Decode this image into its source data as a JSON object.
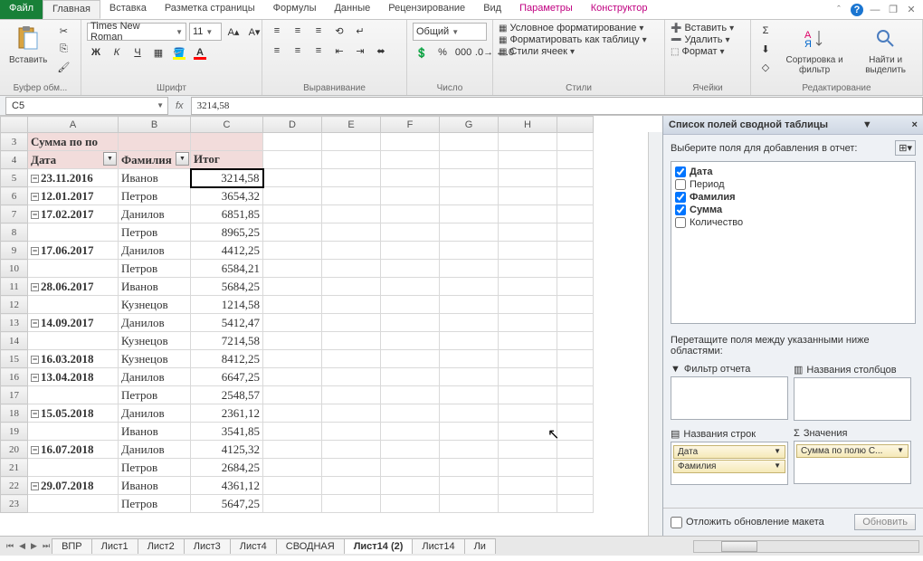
{
  "tabs": {
    "file": "Файл",
    "home": "Главная",
    "insert": "Вставка",
    "layout": "Разметка страницы",
    "formulas": "Формулы",
    "data": "Данные",
    "review": "Рецензирование",
    "view": "Вид",
    "params": "Параметры",
    "design": "Конструктор"
  },
  "font": {
    "name": "Times New Roman",
    "size": "11"
  },
  "number_format": "Общий",
  "styles": {
    "cond": "Условное форматирование",
    "table": "Форматировать как таблицу",
    "cell": "Стили ячеек"
  },
  "cells": {
    "insert": "Вставить",
    "delete": "Удалить",
    "format": "Формат"
  },
  "edit": {
    "sort": "Сортировка и фильтр",
    "find": "Найти и выделить"
  },
  "paste": "Вставить",
  "groups": {
    "clip": "Буфер обм...",
    "font": "Шрифт",
    "align": "Выравнивание",
    "number": "Число",
    "styles": "Стили",
    "cells": "Ячейки",
    "edit": "Редактирование"
  },
  "namebox": "C5",
  "formula": "3214,58",
  "cols": [
    "A",
    "B",
    "C",
    "D",
    "E",
    "F",
    "G",
    "H"
  ],
  "row_start": 3,
  "a3": "Сумма по по",
  "headers": {
    "a": "Дата",
    "b": "Фамилия",
    "c": "Итог"
  },
  "rows": [
    {
      "r": 5,
      "d": "23.11.2016",
      "n": "Иванов",
      "v": "3214,58",
      "c": true
    },
    {
      "r": 6,
      "d": "12.01.2017",
      "n": "Петров",
      "v": "3654,32",
      "c": true
    },
    {
      "r": 7,
      "d": "17.02.2017",
      "n": "Данилов",
      "v": "6851,85",
      "c": true
    },
    {
      "r": 8,
      "d": "",
      "n": "Петров",
      "v": "8965,25"
    },
    {
      "r": 9,
      "d": "17.06.2017",
      "n": "Данилов",
      "v": "4412,25",
      "c": true
    },
    {
      "r": 10,
      "d": "",
      "n": "Петров",
      "v": "6584,21"
    },
    {
      "r": 11,
      "d": "28.06.2017",
      "n": "Иванов",
      "v": "5684,25",
      "c": true
    },
    {
      "r": 12,
      "d": "",
      "n": "Кузнецов",
      "v": "1214,58"
    },
    {
      "r": 13,
      "d": "14.09.2017",
      "n": "Данилов",
      "v": "5412,47",
      "c": true
    },
    {
      "r": 14,
      "d": "",
      "n": "Кузнецов",
      "v": "7214,58"
    },
    {
      "r": 15,
      "d": "16.03.2018",
      "n": "Кузнецов",
      "v": "8412,25",
      "c": true
    },
    {
      "r": 16,
      "d": "13.04.2018",
      "n": "Данилов",
      "v": "6647,25",
      "c": true
    },
    {
      "r": 17,
      "d": "",
      "n": "Петров",
      "v": "2548,57"
    },
    {
      "r": 18,
      "d": "15.05.2018",
      "n": "Данилов",
      "v": "2361,12",
      "c": true
    },
    {
      "r": 19,
      "d": "",
      "n": "Иванов",
      "v": "3541,85"
    },
    {
      "r": 20,
      "d": "16.07.2018",
      "n": "Данилов",
      "v": "4125,32",
      "c": true
    },
    {
      "r": 21,
      "d": "",
      "n": "Петров",
      "v": "2684,25"
    },
    {
      "r": 22,
      "d": "29.07.2018",
      "n": "Иванов",
      "v": "4361,12",
      "c": true
    },
    {
      "r": 23,
      "d": "",
      "n": "Петров",
      "v": "5647,25"
    }
  ],
  "pane": {
    "title": "Список полей сводной таблицы",
    "choose": "Выберите поля для добавления в отчет:",
    "fields": [
      {
        "label": "Дата",
        "checked": true
      },
      {
        "label": "Период",
        "checked": false
      },
      {
        "label": "Фамилия",
        "checked": true
      },
      {
        "label": "Сумма",
        "checked": true
      },
      {
        "label": "Количество",
        "checked": false
      }
    ],
    "drag": "Перетащите поля между указанными ниже областями:",
    "areas": {
      "filter": "Фильтр отчета",
      "cols": "Названия столбцов",
      "rows": "Названия строк",
      "vals": "Значения"
    },
    "row_items": [
      "Дата",
      "Фамилия"
    ],
    "val_items": [
      "Сумма по полю С..."
    ],
    "defer": "Отложить обновление макета",
    "update": "Обновить"
  },
  "sheets": [
    "ВПР",
    "Лист1",
    "Лист2",
    "Лист3",
    "Лист4",
    "СВОДНАЯ",
    "Лист14 (2)",
    "Лист14",
    "Ли"
  ]
}
